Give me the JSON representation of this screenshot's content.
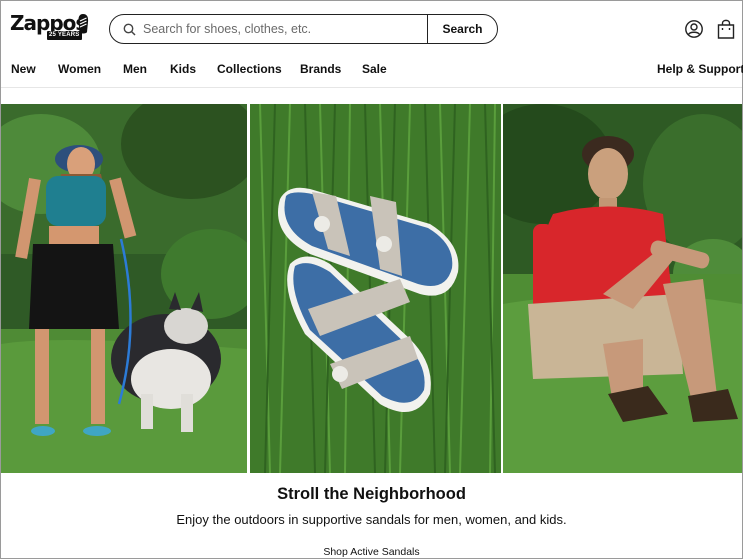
{
  "brand": {
    "logo_text": "Zappos",
    "logo_badge": "25 YEARS"
  },
  "search": {
    "placeholder": "Search for shoes, clothes, etc.",
    "value": "",
    "button_label": "Search"
  },
  "header_icons": [
    "user-account-icon",
    "shopping-bag-icon"
  ],
  "nav": {
    "items": [
      {
        "label": "New"
      },
      {
        "label": "Women"
      },
      {
        "label": "Men"
      },
      {
        "label": "Kids"
      },
      {
        "label": "Collections"
      },
      {
        "label": "Brands"
      },
      {
        "label": "Sale"
      }
    ],
    "help_label": "Help & Support"
  },
  "hero": {
    "images": [
      {
        "name": "woman-walking-husky"
      },
      {
        "name": "blue-kids-sandals-on-grass"
      },
      {
        "name": "man-sitting-in-sandals"
      }
    ]
  },
  "promo": {
    "title": "Stroll the Neighborhood",
    "subtitle": "Enjoy the outdoors in supportive sandals for men, women, and kids.",
    "cta_label": "Shop Active Sandals"
  },
  "colors": {
    "text": "#111111",
    "border": "#222222",
    "grass": "#4d8a32",
    "shirt_red": "#d8262b",
    "sandal_blue": "#3f6fa8"
  }
}
